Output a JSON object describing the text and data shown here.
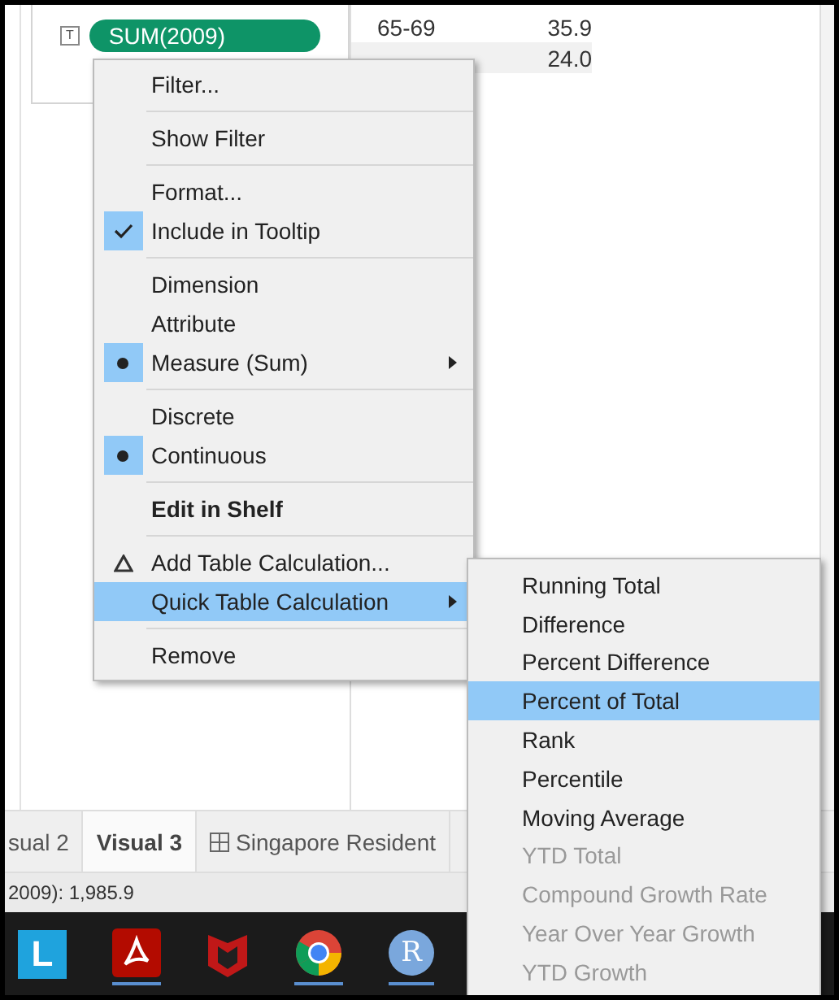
{
  "marks_card": {
    "mark_type_icon": "T",
    "pill": "SUM(2009)"
  },
  "table": {
    "rows": [
      {
        "label": "65-69",
        "value": "35.9",
        "highlighted": false
      },
      {
        "value": "24.0",
        "highlighted": true
      }
    ]
  },
  "context_menu": {
    "groups": [
      [
        {
          "label": "Filter...",
          "kind": "plain",
          "selected": false,
          "has_submenu": false
        }
      ],
      [
        {
          "label": "Show Filter",
          "kind": "plain",
          "selected": false,
          "has_submenu": false
        }
      ],
      [
        {
          "label": "Format...",
          "kind": "plain",
          "selected": false,
          "has_submenu": false
        },
        {
          "label": "Include in Tooltip",
          "kind": "check",
          "checked": true,
          "selected": false,
          "has_submenu": false
        }
      ],
      [
        {
          "label": "Dimension",
          "kind": "radio",
          "checked": false,
          "selected": false,
          "has_submenu": false
        },
        {
          "label": "Attribute",
          "kind": "radio",
          "checked": false,
          "selected": false,
          "has_submenu": false
        },
        {
          "label": "Measure (Sum)",
          "kind": "radio",
          "checked": true,
          "selected": false,
          "has_submenu": true
        }
      ],
      [
        {
          "label": "Discrete",
          "kind": "radio",
          "checked": false,
          "selected": false,
          "has_submenu": false
        },
        {
          "label": "Continuous",
          "kind": "radio",
          "checked": true,
          "selected": false,
          "has_submenu": false
        }
      ],
      [
        {
          "label": "Edit in Shelf",
          "kind": "default",
          "selected": false,
          "has_submenu": false
        }
      ],
      [
        {
          "label": "Add Table Calculation...",
          "kind": "calc",
          "selected": false,
          "has_submenu": false
        },
        {
          "label": "Quick Table Calculation",
          "kind": "plain",
          "selected": true,
          "has_submenu": true
        }
      ],
      [
        {
          "label": "Remove",
          "kind": "plain",
          "selected": false,
          "has_submenu": false
        }
      ]
    ]
  },
  "submenu": {
    "items": [
      {
        "label": "Running Total",
        "selected": false,
        "disabled": false
      },
      {
        "label": "Difference",
        "selected": false,
        "disabled": false
      },
      {
        "label": "Percent Difference",
        "selected": false,
        "disabled": false
      },
      {
        "label": "Percent of Total",
        "selected": true,
        "disabled": false
      },
      {
        "label": "Rank",
        "selected": false,
        "disabled": false
      },
      {
        "label": "Percentile",
        "selected": false,
        "disabled": false
      },
      {
        "label": "Moving Average",
        "selected": false,
        "disabled": false
      },
      {
        "label": "YTD Total",
        "selected": false,
        "disabled": true
      },
      {
        "label": "Compound Growth Rate",
        "selected": false,
        "disabled": true
      },
      {
        "label": "Year Over Year Growth",
        "selected": false,
        "disabled": true
      },
      {
        "label": "YTD Growth",
        "selected": false,
        "disabled": true
      }
    ]
  },
  "sheet_tabs": [
    {
      "label": "sual 2",
      "selected": false,
      "kind": "sheet"
    },
    {
      "label": "Visual 3",
      "selected": true,
      "kind": "sheet"
    },
    {
      "label": "Singapore Resident",
      "selected": false,
      "kind": "datasource"
    }
  ],
  "status_bar": {
    "text": "2009): 1,985.9"
  },
  "taskbar": {
    "letter_icon": "L",
    "r_icon": "R"
  }
}
